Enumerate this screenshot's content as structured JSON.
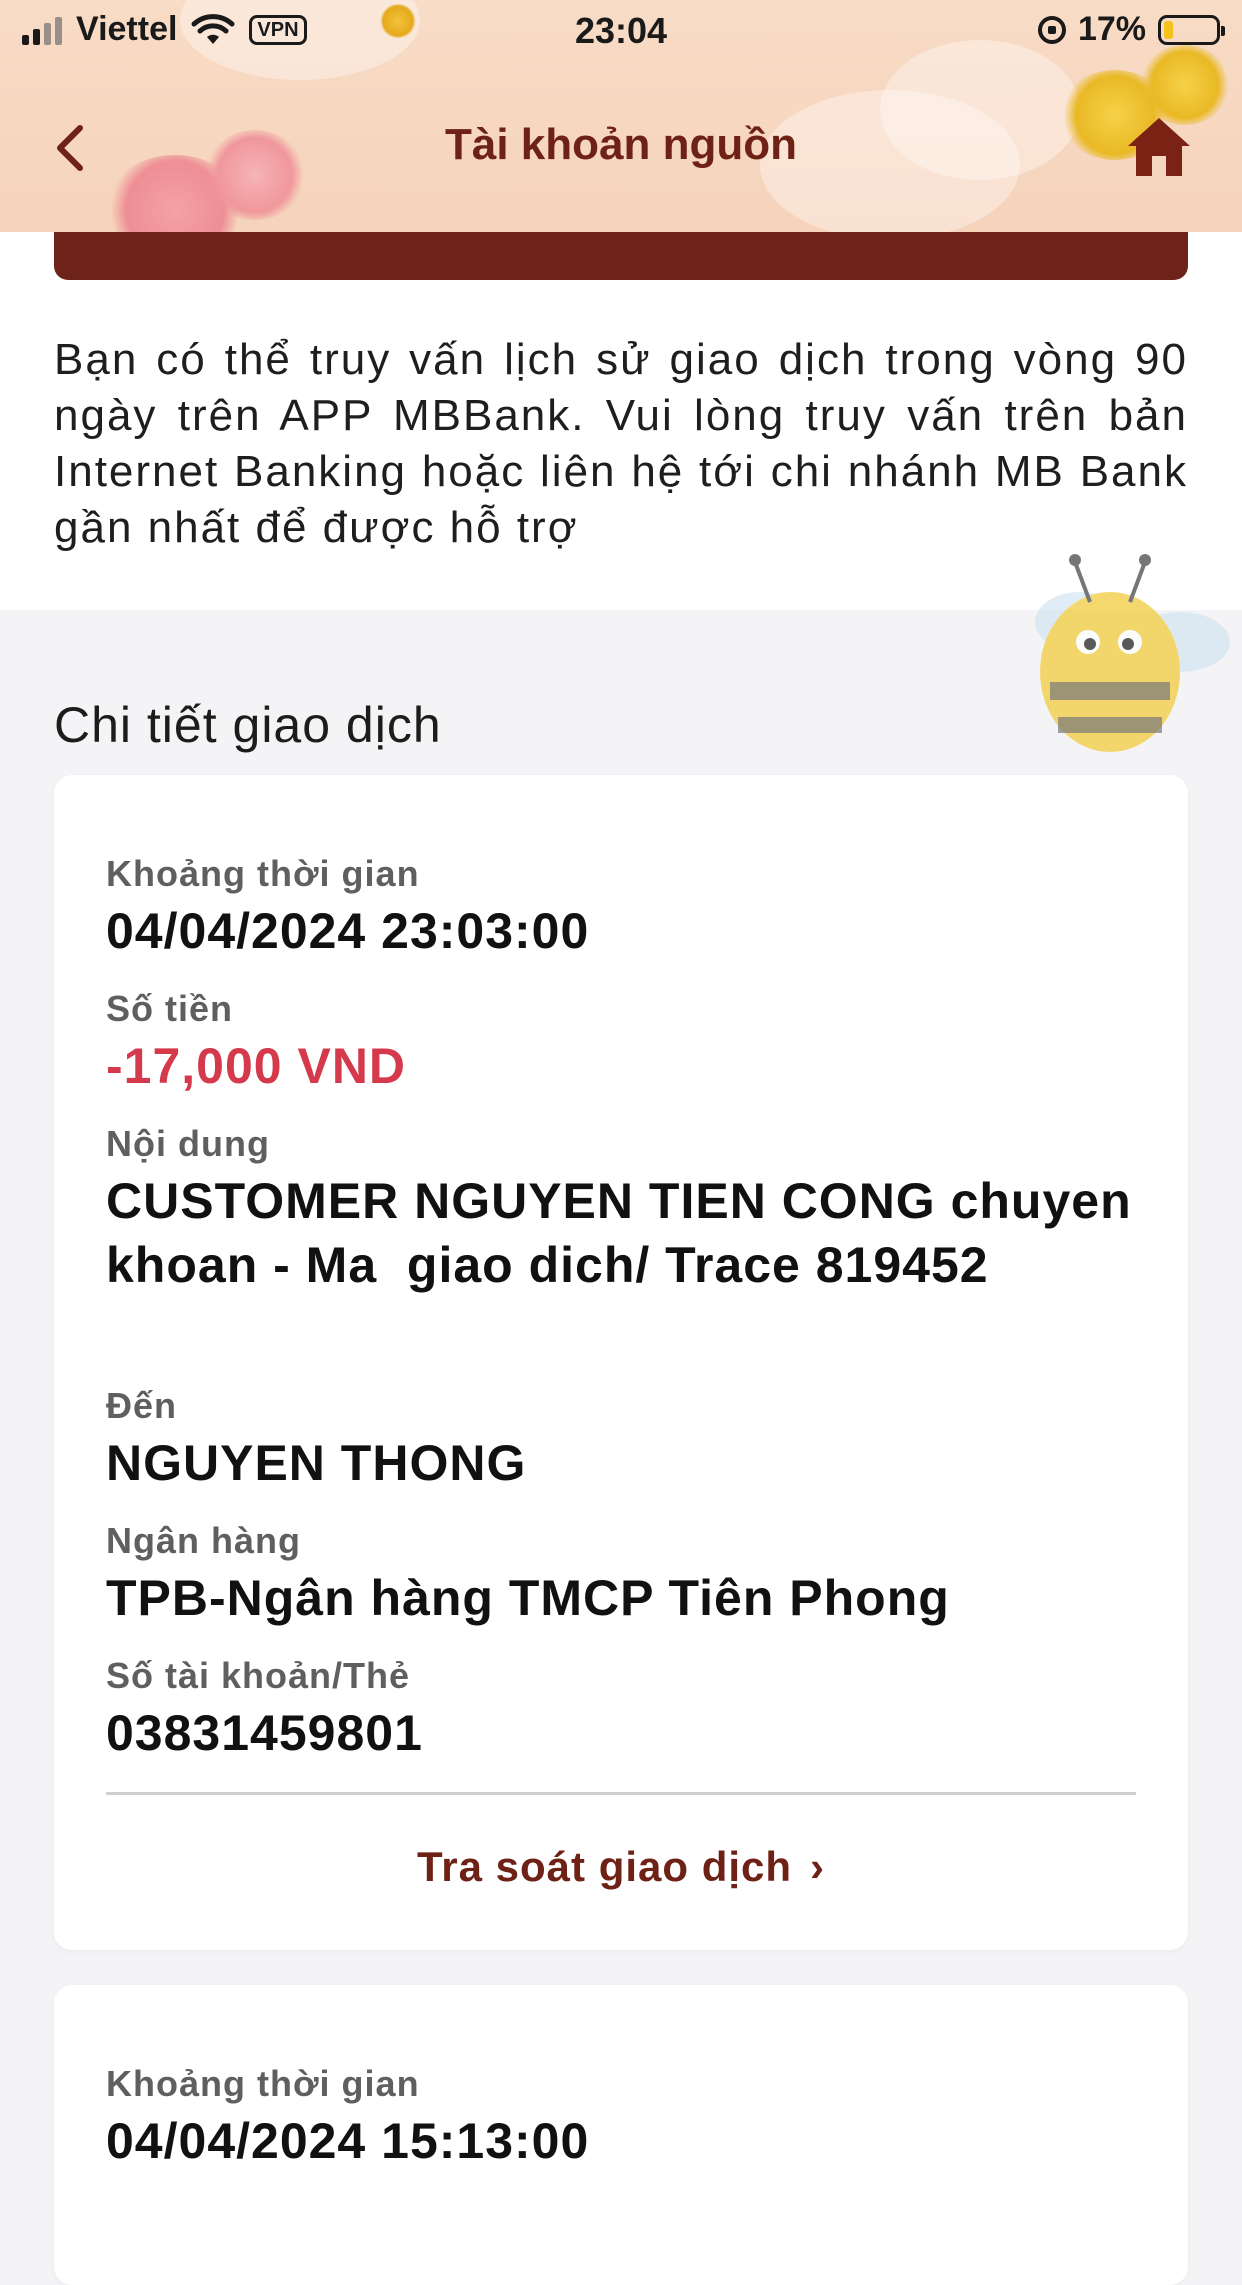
{
  "status_bar": {
    "carrier": "Viettel",
    "vpn": "VPN",
    "time": "23:04",
    "battery": "17%",
    "battery_level": 0.17
  },
  "nav": {
    "title": "Tài khoản nguồn",
    "back_icon": "chevron-left-icon",
    "home_icon": "home-icon"
  },
  "notice": {
    "text": "Bạn có thể truy vấn lịch sử giao dịch trong vòng 90 ngày trên APP MBBank. Vui lòng truy vấn trên bản Internet Banking hoặc liên hệ tới chi nhánh MB Bank gần nhất để được hỗ trợ"
  },
  "details": {
    "section_title": "Chi tiết giao dịch",
    "transactions": [
      {
        "time_label": "Khoảng thời gian",
        "time": "04/04/2024 23:03:00",
        "amount_label": "Số tiền",
        "amount": "-17,000 VND",
        "content_label": "Nội dung",
        "content": "CUSTOMER NGUYEN TIEN CONG chuyen khoan - Ma  giao dich/ Trace 819452",
        "to_label": "Đến",
        "to": "NGUYEN THONG",
        "bank_label": "Ngân hàng",
        "bank": "TPB-Ngân hàng TMCP Tiên Phong",
        "account_label": "Số tài khoản/Thẻ",
        "account": "03831459801",
        "trace_link": "Tra soát giao dịch"
      },
      {
        "time_label": "Khoảng thời gian",
        "time": "04/04/2024 15:13:00"
      }
    ]
  },
  "colors": {
    "header_bg": "#f7d7c0",
    "brand_dark": "#6e2216",
    "amount_negative": "#d43a4b"
  }
}
